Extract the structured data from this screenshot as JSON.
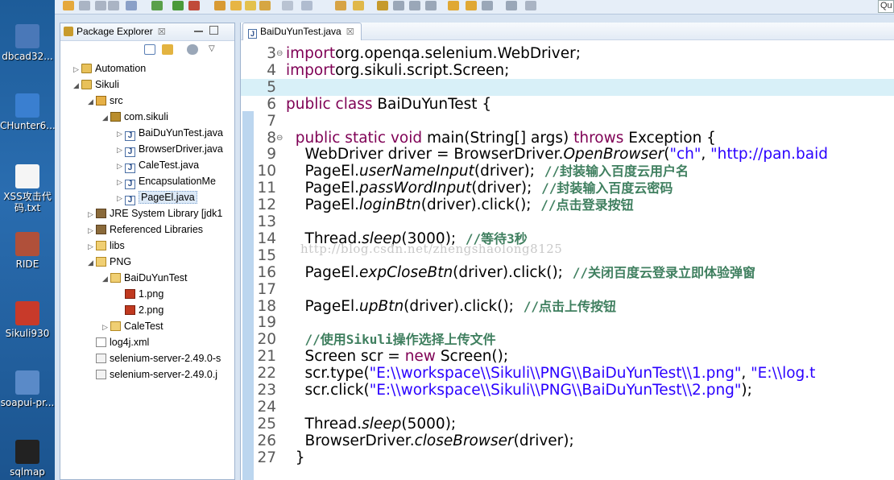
{
  "desktop": {
    "icons": [
      {
        "label": "dbcad32...",
        "icon": "dbcad-app-icon",
        "color": "#4a78b8"
      },
      {
        "label": "CHunter6...",
        "icon": "chunter-app-icon",
        "color": "#3a7fd0"
      },
      {
        "label": "XSS攻击代码.txt",
        "label_line1": "XSS攻击代",
        "label_line2": "码.txt",
        "icon": "text-file-icon",
        "color": "#f5f5f5"
      },
      {
        "label": "RIDE",
        "icon": "ride-app-icon",
        "color": "#b0503a"
      },
      {
        "label": "Sikuli930",
        "icon": "sikuli-app-icon",
        "color": "#c83a2a"
      },
      {
        "label": "soapui-pr...",
        "icon": "soapui-app-icon",
        "color": "#5a8ac8"
      },
      {
        "label": "sqlmap",
        "icon": "sqlmap-app-icon",
        "color": "#222222"
      }
    ]
  },
  "toolbar": {
    "quick_access": "Qu"
  },
  "package_explorer": {
    "title": "Package Explorer",
    "close": "☒",
    "tree": [
      {
        "label": "Automation",
        "icon": "project-icon",
        "twisty": "▷"
      },
      {
        "label": "Sikuli",
        "icon": "project-icon",
        "twisty": "◢"
      },
      {
        "label": "src",
        "icon": "source-folder-icon",
        "twisty": "◢"
      },
      {
        "label": "com.sikuli",
        "icon": "package-icon",
        "twisty": "◢"
      },
      {
        "label": "BaiDuYunTest.java",
        "icon": "java-file-icon",
        "twisty": "▷"
      },
      {
        "label": "BrowserDriver.java",
        "icon": "java-file-icon",
        "twisty": "▷"
      },
      {
        "label": "CaleTest.java",
        "icon": "java-file-icon",
        "twisty": "▷"
      },
      {
        "label": "EncapsulationMe",
        "icon": "java-file-icon",
        "twisty": "▷"
      },
      {
        "label": "PageEl.java",
        "icon": "java-file-icon",
        "twisty": "▷",
        "selected": true
      },
      {
        "label": "JRE System Library [jdk1",
        "icon": "library-icon",
        "twisty": "▷"
      },
      {
        "label": "Referenced Libraries",
        "icon": "library-icon",
        "twisty": "▷"
      },
      {
        "label": "libs",
        "icon": "folder-icon",
        "twisty": "▷"
      },
      {
        "label": "PNG",
        "icon": "folder-icon",
        "twisty": "◢"
      },
      {
        "label": "BaiDuYunTest",
        "icon": "folder-icon",
        "twisty": "◢"
      },
      {
        "label": "1.png",
        "icon": "png-file-icon",
        "twisty": ""
      },
      {
        "label": "2.png",
        "icon": "png-file-icon",
        "twisty": ""
      },
      {
        "label": "CaleTest",
        "icon": "folder-icon",
        "twisty": "▷"
      },
      {
        "label": "log4j.xml",
        "icon": "xml-file-icon",
        "twisty": ""
      },
      {
        "label": "selenium-server-2.49.0-s",
        "icon": "jar-file-icon",
        "twisty": ""
      },
      {
        "label": "selenium-server-2.49.0.j",
        "icon": "jar-file-icon",
        "twisty": ""
      }
    ]
  },
  "editor": {
    "tab_title": "BaiDuYunTest.java",
    "tab_close": "☒",
    "watermark": "http://blog.csdn.net/zhengshaolong8125",
    "colors": {
      "keyword": "#7f0055",
      "string": "#2a00ff",
      "comment": "#3f7f5f",
      "highlight": "#d8f0f8"
    },
    "lines": [
      {
        "n": "3",
        "fold": "⊖",
        "segs": [
          [
            "kw",
            "import"
          ],
          [
            "",
            "org.openqa.selenium.WebDriver;"
          ]
        ]
      },
      {
        "n": "4",
        "fold": "",
        "segs": [
          [
            "kw",
            "import"
          ],
          [
            "",
            "org.sikuli.script.Screen;"
          ]
        ]
      },
      {
        "n": "5",
        "fold": "",
        "hl": true,
        "segs": []
      },
      {
        "n": "6",
        "fold": "",
        "segs": [
          [
            "kw",
            "public class"
          ],
          [
            "",
            " BaiDuYunTest {"
          ]
        ]
      },
      {
        "n": "7",
        "fold": "",
        "segs": []
      },
      {
        "n": "8",
        "fold": "⊖",
        "segs": [
          [
            "",
            "  "
          ],
          [
            "kw",
            "public static void"
          ],
          [
            "",
            " main(String[] args) "
          ],
          [
            "kw",
            "throws"
          ],
          [
            "",
            " Exception {"
          ]
        ]
      },
      {
        "n": "9",
        "fold": "",
        "segs": [
          [
            "",
            "    WebDriver driver = BrowserDriver."
          ],
          [
            "it",
            "OpenBrowser"
          ],
          [
            "",
            "("
          ],
          [
            "str",
            "\"ch\""
          ],
          [
            ", ",
            ""
          ],
          [
            "str",
            "\"http://pan.baid"
          ]
        ]
      },
      {
        "n": "10",
        "fold": "",
        "segs": [
          [
            "",
            "    PageEl."
          ],
          [
            "it",
            "userNameInput"
          ],
          [
            "",
            "(driver);  "
          ],
          [
            "cm",
            "//封装输入百度云用户名"
          ]
        ]
      },
      {
        "n": "11",
        "fold": "",
        "segs": [
          [
            "",
            "    PageEl."
          ],
          [
            "it",
            "passWordInput"
          ],
          [
            "",
            "(driver);  "
          ],
          [
            "cm",
            "//封装输入百度云密码"
          ]
        ]
      },
      {
        "n": "12",
        "fold": "",
        "segs": [
          [
            "",
            "    PageEl."
          ],
          [
            "it",
            "loginBtn"
          ],
          [
            "",
            "(driver).click();  "
          ],
          [
            "cm",
            "//点击登录按钮"
          ]
        ]
      },
      {
        "n": "13",
        "fold": "",
        "segs": []
      },
      {
        "n": "14",
        "fold": "",
        "segs": [
          [
            "",
            "    Thread."
          ],
          [
            "it",
            "sleep"
          ],
          [
            "",
            "(3000);  "
          ],
          [
            "cm",
            "//等待3秒"
          ]
        ]
      },
      {
        "n": "15",
        "fold": "",
        "segs": []
      },
      {
        "n": "16",
        "fold": "",
        "segs": [
          [
            "",
            "    PageEl."
          ],
          [
            "it",
            "expCloseBtn"
          ],
          [
            "",
            "(driver).click();  "
          ],
          [
            "cm",
            "//关闭百度云登录立即体验弹窗"
          ]
        ]
      },
      {
        "n": "17",
        "fold": "",
        "segs": []
      },
      {
        "n": "18",
        "fold": "",
        "segs": [
          [
            "",
            "    PageEl."
          ],
          [
            "it",
            "upBtn"
          ],
          [
            "",
            "(driver).click();  "
          ],
          [
            "cm",
            "//点击上传按钮"
          ]
        ]
      },
      {
        "n": "19",
        "fold": "",
        "segs": []
      },
      {
        "n": "20",
        "fold": "",
        "segs": [
          [
            "",
            "    "
          ],
          [
            "cm",
            "//使用Sikuli操作选择上传文件"
          ]
        ]
      },
      {
        "n": "21",
        "fold": "",
        "segs": [
          [
            "",
            "    Screen scr = "
          ],
          [
            "kw",
            "new"
          ],
          [
            "",
            " Screen();"
          ]
        ]
      },
      {
        "n": "22",
        "fold": "",
        "segs": [
          [
            "",
            "    scr.type("
          ],
          [
            "str",
            "\"E:\\\\workspace\\\\Sikuli\\\\PNG\\\\BaiDuYunTest\\\\1.png\""
          ],
          [
            "",
            ", "
          ],
          [
            "str",
            "\"E:\\\\log.t"
          ]
        ]
      },
      {
        "n": "23",
        "fold": "",
        "segs": [
          [
            "",
            "    scr.click("
          ],
          [
            "str",
            "\"E:\\\\workspace\\\\Sikuli\\\\PNG\\\\BaiDuYunTest\\\\2.png\""
          ],
          [
            "",
            ");"
          ]
        ]
      },
      {
        "n": "24",
        "fold": "",
        "segs": []
      },
      {
        "n": "25",
        "fold": "",
        "segs": [
          [
            "",
            "    Thread."
          ],
          [
            "it",
            "sleep"
          ],
          [
            "",
            "(5000);"
          ]
        ]
      },
      {
        "n": "26",
        "fold": "",
        "segs": [
          [
            "",
            "    BrowserDriver."
          ],
          [
            "it",
            "closeBrowser"
          ],
          [
            "",
            "(driver);"
          ]
        ]
      },
      {
        "n": "27",
        "fold": "",
        "segs": [
          [
            "",
            "  }"
          ]
        ]
      }
    ]
  }
}
